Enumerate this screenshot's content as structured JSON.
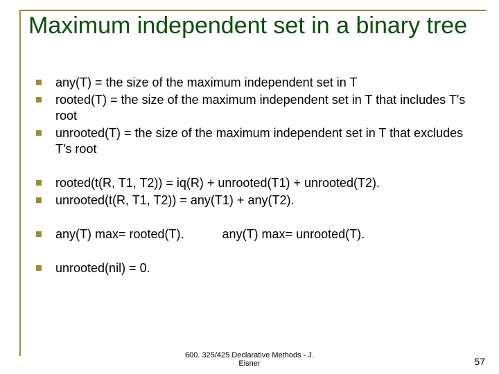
{
  "title": "Maximum independent set in a binary tree",
  "bullets": {
    "g1": [
      "any(T) = the size of the maximum independent set in T",
      "rooted(T) = the size of the maximum independent set in T that includes T's root",
      "unrooted(T) = the size of the maximum independent set in T that excludes T's root"
    ],
    "g2": [
      "rooted(t(R, T1, T2)) = iq(R) + unrooted(T1) + unrooted(T2).",
      "unrooted(t(R, T1, T2)) = any(T1) + any(T2)."
    ],
    "g3a": "any(T) max= rooted(T).",
    "g3b": "any(T) max= unrooted(T).",
    "g4": "unrooted(nil) = 0."
  },
  "footer": {
    "line1": "600. 325/425 Declarative Methods - J.",
    "line2": "Eisner"
  },
  "page": "57"
}
